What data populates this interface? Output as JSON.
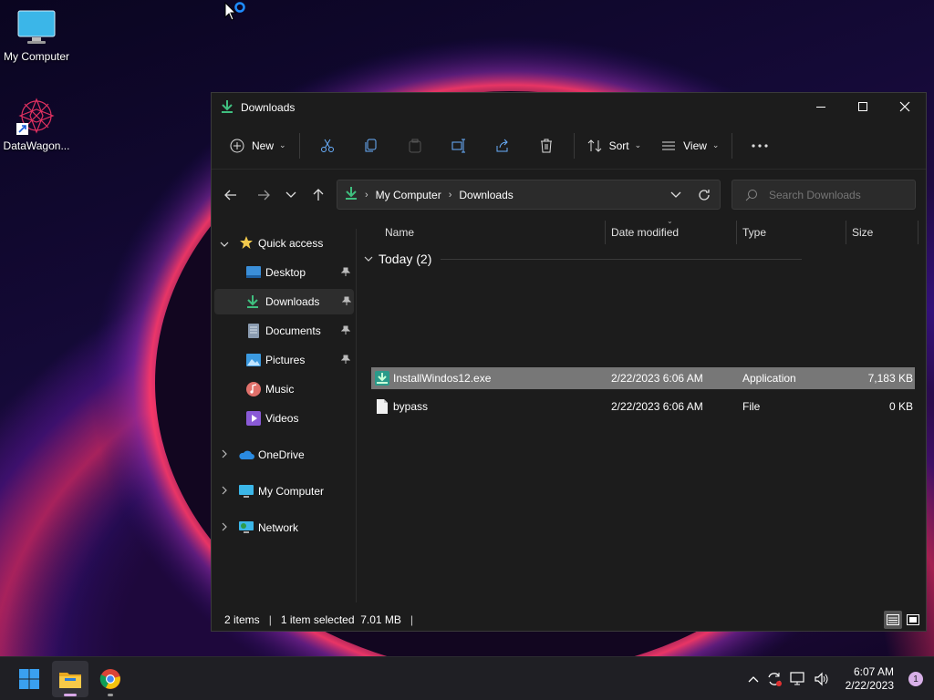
{
  "desktop": {
    "icons": [
      {
        "label": "My Computer"
      },
      {
        "label": "DataWagon..."
      }
    ]
  },
  "window": {
    "title": "Downloads",
    "toolbar": {
      "new_label": "New",
      "sort_label": "Sort",
      "view_label": "View"
    },
    "address": {
      "crumbs": [
        "My Computer",
        "Downloads"
      ],
      "search_placeholder": "Search Downloads"
    },
    "sidebar": {
      "quick_access": "Quick access",
      "items": [
        {
          "label": "Desktop",
          "pinned": true
        },
        {
          "label": "Downloads",
          "pinned": true,
          "selected": true
        },
        {
          "label": "Documents",
          "pinned": true
        },
        {
          "label": "Pictures",
          "pinned": true
        },
        {
          "label": "Music",
          "pinned": false
        },
        {
          "label": "Videos",
          "pinned": false
        }
      ],
      "roots": [
        {
          "label": "OneDrive"
        },
        {
          "label": "My Computer"
        },
        {
          "label": "Network"
        }
      ]
    },
    "columns": {
      "name": "Name",
      "date": "Date modified",
      "type": "Type",
      "size": "Size"
    },
    "group_label": "Today (2)",
    "files": [
      {
        "name": "InstallWindos12.exe",
        "date": "2/22/2023 6:06 AM",
        "type": "Application",
        "size": "7,183 KB",
        "selected": true
      },
      {
        "name": "bypass",
        "date": "2/22/2023 6:06 AM",
        "type": "File",
        "size": "0 KB",
        "selected": false
      }
    ],
    "status": {
      "count": "2 items",
      "selection": "1 item selected  7.01 MB"
    }
  },
  "taskbar": {
    "time": "6:07 AM",
    "date": "2/22/2023",
    "notification_count": "1"
  },
  "colors": {
    "accent_green": "#3fbf7f",
    "folder_yellow": "#f2c94c",
    "window_bg": "#1c1c1c",
    "selection_bg": "#777777"
  }
}
